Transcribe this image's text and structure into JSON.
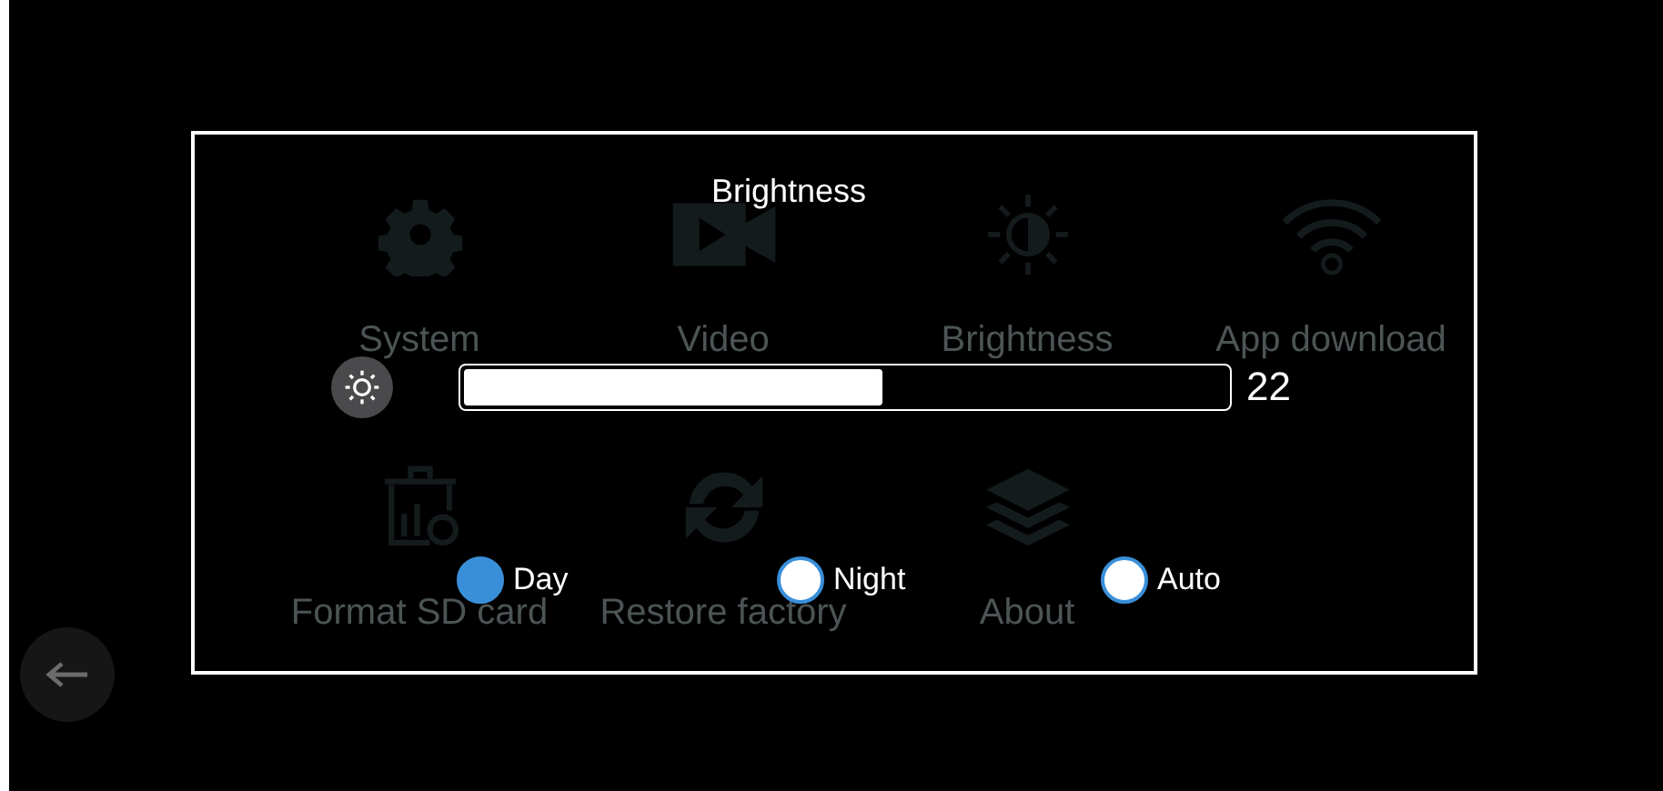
{
  "background_tiles": [
    {
      "label": "System",
      "kind": "gear"
    },
    {
      "label": "Video",
      "kind": "video"
    },
    {
      "label": "Brightness",
      "kind": "brightness"
    },
    {
      "label": "App download",
      "kind": "wifi"
    },
    {
      "label": "Format SD card",
      "kind": "format"
    },
    {
      "label": "Restore factory",
      "kind": "restore"
    },
    {
      "label": "About",
      "kind": "layers"
    }
  ],
  "dialog": {
    "title": "Brightness",
    "slider": {
      "level": 0.55,
      "reading": "22"
    },
    "modes": [
      {
        "label": "Day",
        "selected": true
      },
      {
        "label": "Night",
        "selected": false
      },
      {
        "label": "Auto",
        "selected": false
      }
    ]
  }
}
